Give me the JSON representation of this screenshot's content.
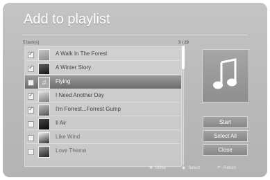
{
  "title": "Add to playlist",
  "list_header": {
    "item_count": "5 item(s)",
    "page_indicator": "3 / 29"
  },
  "items": [
    {
      "name": "A Walk In The Forest",
      "checked": true
    },
    {
      "name": "A Winter Story",
      "checked": true
    },
    {
      "name": "Flying",
      "checked": false
    },
    {
      "name": "I Need Another Day",
      "checked": true
    },
    {
      "name": "I'm Forrest...Forrest Gump",
      "checked": true
    },
    {
      "name": "Il Air",
      "checked": false
    },
    {
      "name": "Like Wind",
      "checked": false
    },
    {
      "name": "Love Theme",
      "checked": false
    }
  ],
  "preview": {
    "icon": "music-note-icon"
  },
  "buttons": {
    "start": "Start",
    "select_all": "Select All",
    "close": "Close"
  },
  "guide": {
    "move": "Move",
    "select": "Select",
    "return": "Return"
  }
}
